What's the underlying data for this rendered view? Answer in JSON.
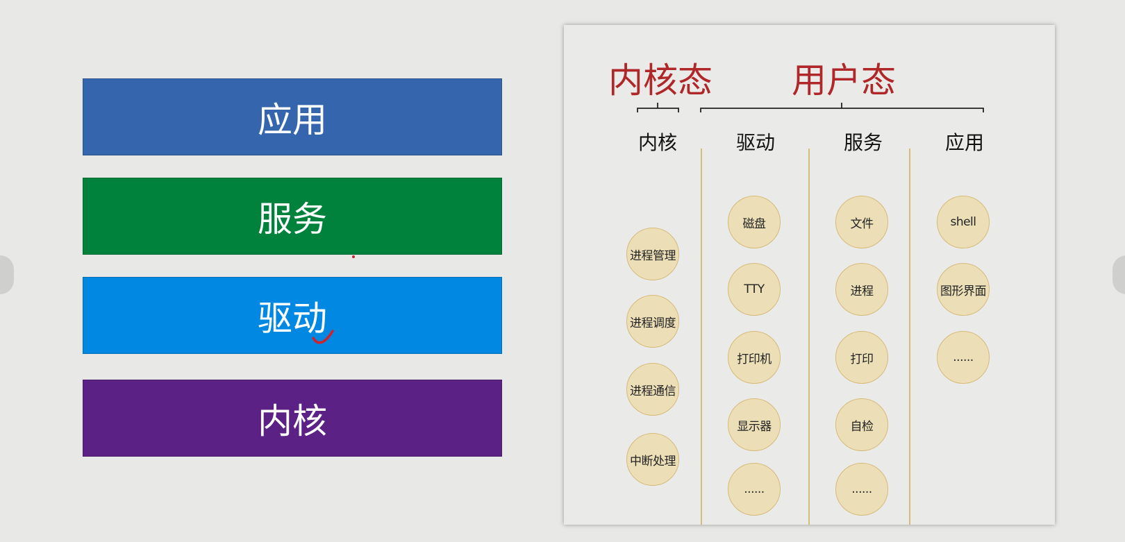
{
  "layers": [
    {
      "label": "应用",
      "color": "#3566ad"
    },
    {
      "label": "服务",
      "color": "#00823c"
    },
    {
      "label": "驱动",
      "color": "#0088e2"
    },
    {
      "label": "内核",
      "color": "#5c2185"
    }
  ],
  "diagram": {
    "kernel_mode_label": "内核态",
    "user_mode_label": "用户态",
    "mode_color": "#b0272a",
    "columns": [
      {
        "header": "内核",
        "nodes": [
          "进程管理",
          "进程调度",
          "进程通信",
          "中断处理"
        ]
      },
      {
        "header": "驱动",
        "nodes": [
          "磁盘",
          "TTY",
          "打印机",
          "显示器",
          "......"
        ]
      },
      {
        "header": "服务",
        "nodes": [
          "文件",
          "进程",
          "打印",
          "自检",
          "......"
        ]
      },
      {
        "header": "应用",
        "nodes": [
          "shell",
          "图形界面",
          "......"
        ]
      }
    ]
  }
}
